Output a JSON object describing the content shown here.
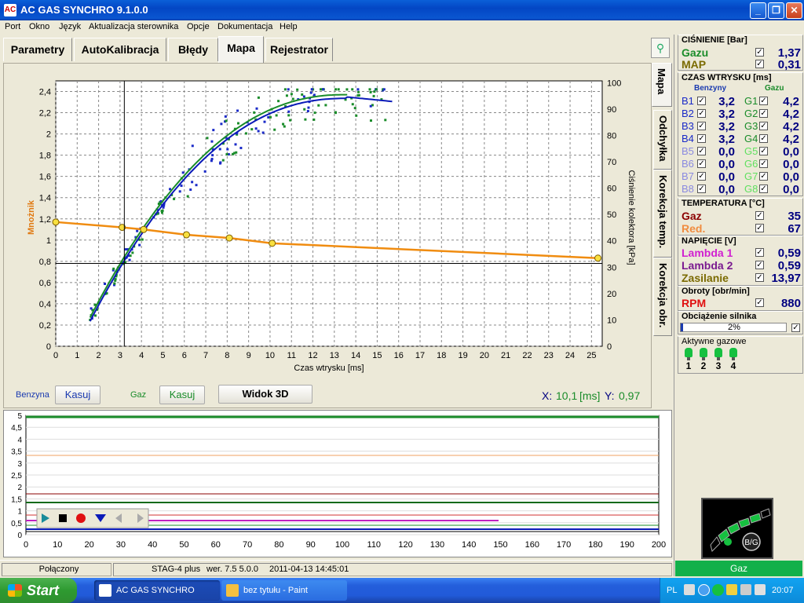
{
  "window": {
    "title": "AC GAS SYNCHRO  9.1.0.0"
  },
  "menu": [
    "Port",
    "Okno",
    "Język",
    "Aktualizacja sterownika",
    "Opcje",
    "Dokumentacja",
    "Help"
  ],
  "tabs": [
    "Parametry",
    "AutoKalibracja",
    "Błędy",
    "Mapa",
    "Rejestrator"
  ],
  "active_tab": "Mapa",
  "vtabs": [
    "Mapa",
    "Odchyłka",
    "Korekcja temp.",
    "Korekcja obr."
  ],
  "map_chart": {
    "ylabel_left": "Mnożnik",
    "ylabel_right": "Ciśnienie kolektora [kPa]",
    "xlabel": "Czas wtrysku [ms]",
    "x_ticks": [
      0,
      1,
      2,
      3,
      4,
      5,
      6,
      7,
      8,
      9,
      10,
      11,
      12,
      13,
      14,
      15,
      16,
      17,
      18,
      19,
      20,
      21,
      22,
      23,
      24,
      25
    ],
    "y_left_ticks": [
      "0",
      "0,2",
      "0,4",
      "0,6",
      "0,8",
      "1",
      "1,2",
      "1,4",
      "1,6",
      "1,8",
      "2",
      "2,2",
      "2,4"
    ],
    "y_right_ticks": [
      "0",
      "10",
      "20",
      "30",
      "40",
      "50",
      "60",
      "70",
      "80",
      "90",
      "100"
    ],
    "multiplier_points": [
      [
        0,
        1.17
      ],
      [
        3.1,
        1.12
      ],
      [
        4.1,
        1.1
      ],
      [
        6.1,
        1.05
      ],
      [
        8.1,
        1.02
      ],
      [
        10.1,
        0.97
      ],
      [
        25.3,
        0.83
      ]
    ],
    "cursor_x": 3.2,
    "cursor_y": 0.78
  },
  "chart_data": [
    {
      "type": "line",
      "title": "",
      "xlabel": "Czas wtrysku [ms]",
      "ylabel": "Mnożnik",
      "xlim": [
        0,
        25.5
      ],
      "ylim": [
        0,
        2.5
      ],
      "series": [
        {
          "values_x": [
            0,
            3.1,
            4.1,
            6.1,
            8.1,
            10.1,
            25.3
          ],
          "values_y": [
            1.17,
            1.12,
            1.1,
            1.05,
            1.02,
            0.97,
            0.83
          ]
        }
      ]
    },
    {
      "type": "line",
      "title": "",
      "xlim": [
        0,
        200
      ],
      "ylim": [
        0,
        5
      ],
      "x_ticks": [
        0,
        10,
        20,
        30,
        40,
        50,
        60,
        70,
        80,
        90,
        100,
        110,
        120,
        130,
        140,
        150,
        160,
        170,
        180,
        190,
        200
      ],
      "y_ticks": [
        "0",
        "0,5",
        "1",
        "1,5",
        "2",
        "2,5",
        "3",
        "3,5",
        "4",
        "4,5",
        "5"
      ]
    }
  ],
  "bottom": {
    "benzyna": "Benzyna",
    "kasuj1": "Kasuj",
    "gaz": "Gaz",
    "kasuj2": "Kasuj",
    "widok": "Widok 3D",
    "xy_label_x": "X:",
    "xy_x": "10,1",
    "xy_unit": "[ms]",
    "xy_label_y": "Y:",
    "xy_y": "0,97"
  },
  "recorder": {
    "x_ticks": [
      "0",
      "10",
      "20",
      "30",
      "40",
      "50",
      "60",
      "70",
      "80",
      "90",
      "100",
      "110",
      "120",
      "130",
      "140",
      "150",
      "160",
      "170",
      "180",
      "190",
      "200"
    ],
    "y_ticks": [
      "0",
      "0,5",
      "1",
      "1,5",
      "2",
      "2,5",
      "3",
      "3,5",
      "4",
      "4,5",
      "5"
    ]
  },
  "status": {
    "conn": "Połączony",
    "device": "STAG-4 plus",
    "ver": "wer. 7.5  5.0.0",
    "date": "2011-04-13 14:45:01"
  },
  "right": {
    "pressure": {
      "title": "CIŚNIENIE [Bar]",
      "gaz_label": "Gazu",
      "gaz": "1,37",
      "map_label": "MAP",
      "map": "0,31"
    },
    "inj": {
      "title": "CZAS WTRYSKU  [ms]",
      "benz": "Benzyny",
      "gazu": "Gazu",
      "rows": [
        {
          "b": "B1",
          "bv": "3,2",
          "g": "G1",
          "gv": "4,2",
          "act": true
        },
        {
          "b": "B2",
          "bv": "3,2",
          "g": "G2",
          "gv": "4,2",
          "act": true
        },
        {
          "b": "B3",
          "bv": "3,2",
          "g": "G3",
          "gv": "4,2",
          "act": true
        },
        {
          "b": "B4",
          "bv": "3,2",
          "g": "G4",
          "gv": "4,2",
          "act": true
        },
        {
          "b": "B5",
          "bv": "0,0",
          "g": "G5",
          "gv": "0,0",
          "act": false
        },
        {
          "b": "B6",
          "bv": "0,0",
          "g": "G6",
          "gv": "0,0",
          "act": false
        },
        {
          "b": "B7",
          "bv": "0,0",
          "g": "G7",
          "gv": "0,0",
          "act": false
        },
        {
          "b": "B8",
          "bv": "0,0",
          "g": "G8",
          "gv": "0,0",
          "act": false
        }
      ]
    },
    "temp": {
      "title": "TEMPERATURA  [°C]",
      "gaz_label": "Gaz",
      "gaz": "35",
      "red_label": "Red.",
      "red": "67"
    },
    "volt": {
      "title": "NAPIĘCIE [V]",
      "l1": "Lambda 1",
      "l1v": "0,59",
      "l2": "Lambda 2",
      "l2v": "0,59",
      "zas": "Zasilanie",
      "zasv": "13,97"
    },
    "rpm": {
      "title": "Obroty [obr/min]",
      "label": "RPM",
      "value": "880"
    },
    "load": {
      "title": "Obciążenie silnika",
      "value": "2%",
      "fraction": 0.02
    },
    "active": {
      "title": "Aktywne gazowe",
      "nums": [
        "1",
        "2",
        "3",
        "4"
      ]
    },
    "switch": {
      "label": "B/G"
    },
    "gaz_status": "Gaz"
  },
  "taskbar": {
    "start": "Start",
    "t1": "AC GAS SYNCHRO",
    "t2": "bez tytułu - Paint",
    "lang": "PL",
    "time": "20:07"
  }
}
